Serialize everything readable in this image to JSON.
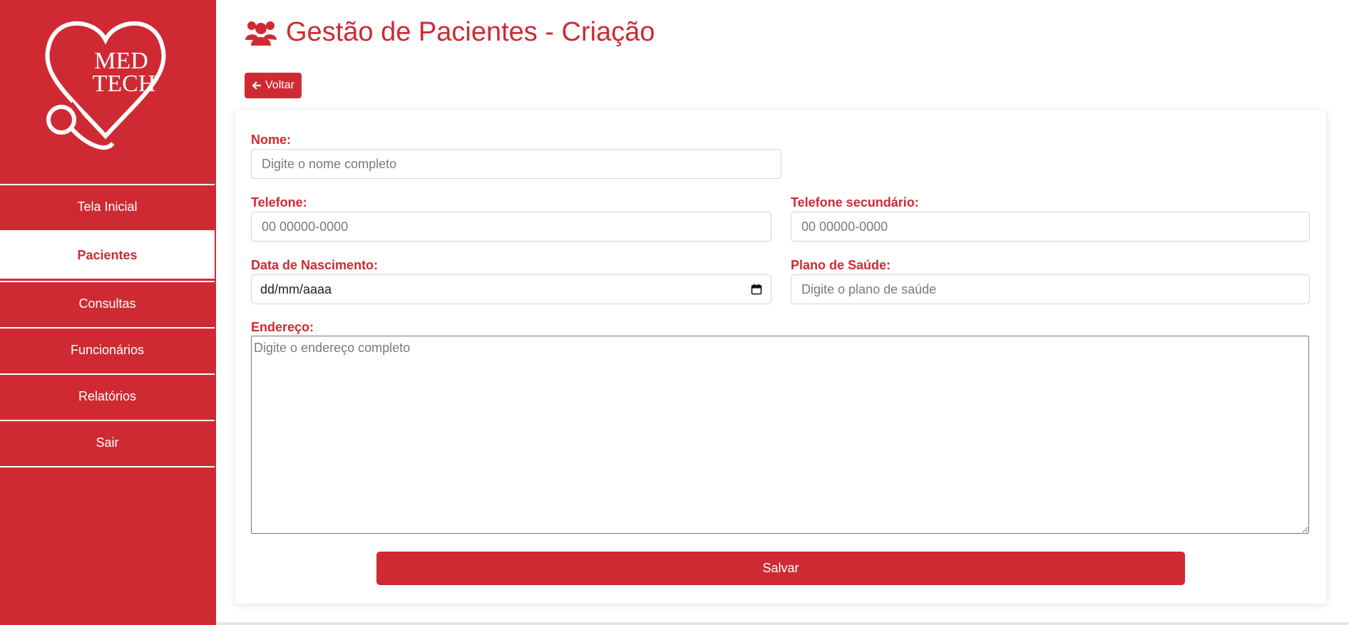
{
  "logo": {
    "line1": "MED",
    "line2": "TECH"
  },
  "sidebar": {
    "items": [
      {
        "label": "Tela Inicial",
        "active": false
      },
      {
        "label": "Pacientes",
        "active": true
      },
      {
        "label": "Consultas",
        "active": false
      },
      {
        "label": "Funcionários",
        "active": false
      },
      {
        "label": "Relatórios",
        "active": false
      },
      {
        "label": "Sair",
        "active": false
      }
    ]
  },
  "header": {
    "title": "Gestão de Pacientes - Criação",
    "icon": "users-icon"
  },
  "back_button": {
    "label": "Voltar",
    "icon": "arrow-left-icon"
  },
  "form": {
    "nome": {
      "label": "Nome:",
      "placeholder": "Digite o nome completo"
    },
    "telefone": {
      "label": "Telefone:",
      "placeholder": "00 00000-0000"
    },
    "telefone_secundario": {
      "label": "Telefone secundário:",
      "placeholder": "00 00000-0000"
    },
    "data_nascimento": {
      "label": "Data de Nascimento:",
      "value": "dd/mm/aaaa",
      "icon": "calendar-icon"
    },
    "plano_saude": {
      "label": "Plano de Saúde:",
      "placeholder": "Digite o plano de saúde"
    },
    "endereco": {
      "label": "Endereço:",
      "placeholder": "Digite o endereço completo"
    },
    "save_label": "Salvar"
  },
  "colors": {
    "accent": "#cf2a33",
    "background": "#ffffff"
  }
}
